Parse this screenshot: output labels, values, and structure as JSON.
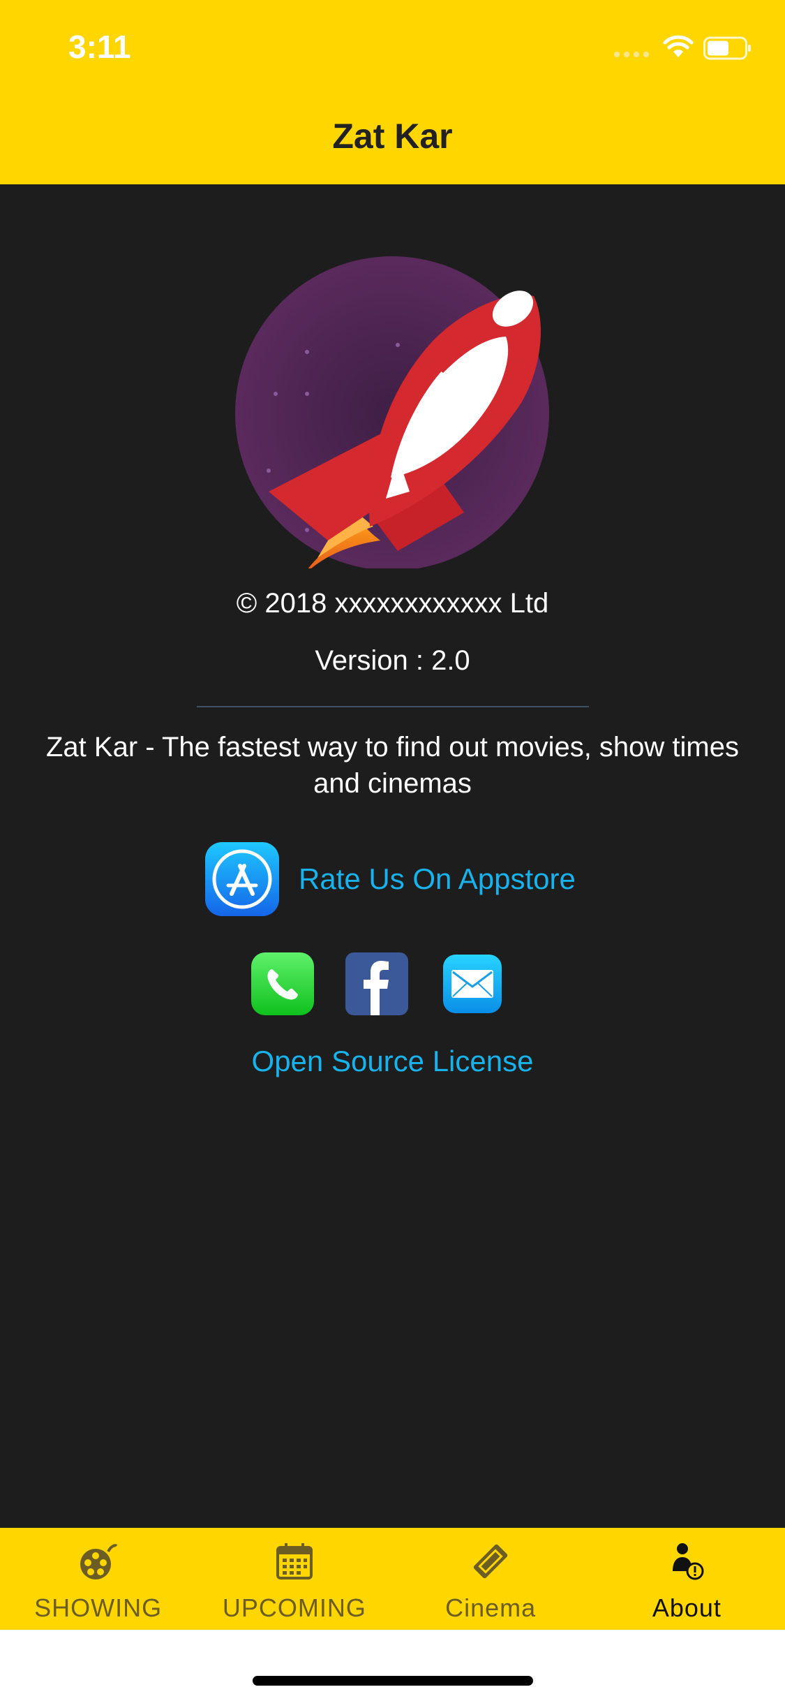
{
  "status_bar": {
    "time": "3:11"
  },
  "nav": {
    "title": "Zat Kar"
  },
  "about": {
    "copyright": "© 2018 xxxxxxxxxxxx Ltd",
    "version": "Version : 2.0",
    "description": "Zat Kar - The fastest way to find out movies, show times and cinemas",
    "rate_label": "Rate Us On Appstore",
    "license_label": "Open Source License"
  },
  "tabs": [
    {
      "label": "SHOWING",
      "icon": "film-reel-icon",
      "active": false
    },
    {
      "label": "UPCOMING",
      "icon": "calendar-icon",
      "active": false
    },
    {
      "label": "Cinema",
      "icon": "ticket-icon",
      "active": false
    },
    {
      "label": "About",
      "icon": "person-info-icon",
      "active": true
    }
  ],
  "colors": {
    "accent": "#ffd600",
    "background": "#1d1d1d",
    "link": "#18b3ec",
    "tab_inactive": "#6b5d24",
    "tab_active": "#111111"
  }
}
